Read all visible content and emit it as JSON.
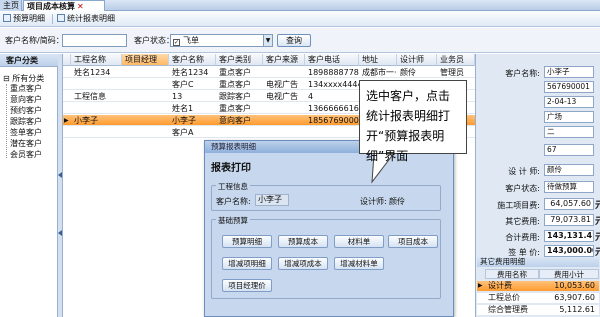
{
  "tabs": [
    {
      "label": "主页"
    },
    {
      "label": "项目成本核算",
      "close": "✕"
    }
  ],
  "toolbar": {
    "budget_detail": "预算明细",
    "print_report": "统计报表明细"
  },
  "search": {
    "name_label": "客户名称/简码：",
    "name_value": "",
    "status_label": "客户状态：",
    "status_value": "飞单",
    "query_button": "查询"
  },
  "left": {
    "title": "客户分类",
    "root": "所有分类",
    "items": [
      "重点客户",
      "意向客户",
      "预约客户",
      "跟踪客户",
      "签单客户",
      "潜在客户",
      "会员客户"
    ]
  },
  "grid": {
    "columns": [
      "工程名称",
      "项目经理",
      "客户名称",
      "客户类别",
      "客户来源",
      "客户电话",
      "地址",
      "设计师",
      "业务员"
    ],
    "rows": [
      [
        "姓名1234",
        "",
        "姓名1234",
        "重点客户",
        "",
        "18988887780",
        "成都市一·4",
        "颜伶",
        "管理员"
      ],
      [
        "",
        "",
        "客户C",
        "重点客户",
        "电视广告",
        "134xxxx4444",
        "",
        "",
        ""
      ],
      [
        "工程信息",
        "",
        "13",
        "跟踪客户",
        "电视广告",
        "4",
        "",
        "",
        ""
      ],
      [
        "",
        "",
        "姓名1",
        "重点客户",
        "",
        "1366666616",
        "",
        "",
        ""
      ],
      [
        "小李子",
        "",
        "小李子",
        "意向客户",
        "",
        "18567690001",
        "",
        "",
        ""
      ],
      [
        "",
        "",
        "客户A",
        "",
        "",
        "",
        "",
        "",
        ""
      ]
    ],
    "selected_marker": "▶"
  },
  "right": {
    "customer_name_label": "客户名称:",
    "customer_name": "小李子",
    "phone": "567690001",
    "date": "2-04-13",
    "source": "广场",
    "area": "二",
    "area2": "67",
    "designer_label": "设 计 师:",
    "designer": "颜伶",
    "status_label": "客户状态:",
    "status": "待做预算",
    "construction_label": "施工项目费:",
    "construction": "64,057.60",
    "other_label": "其它费用:",
    "other": "79,073.81",
    "total_label": "合计费用:",
    "total": "143,131.41",
    "sign_label": "签 单 价:",
    "sign": "143,000.00",
    "unit": "元",
    "other_section": "其它费用明细",
    "other_columns": [
      "费用名称",
      "费用小计"
    ],
    "other_rows": [
      [
        "设计费",
        "10,053.60"
      ],
      [
        "工程总价",
        "63,907.60"
      ],
      [
        "综合管理费",
        "5,112.61"
      ]
    ],
    "row_marker": "▶"
  },
  "dialog": {
    "title": "预算报表明细",
    "heading": "报表打印",
    "group_info": "工程信息",
    "name_label": "客户名称:",
    "name_value": "小李子",
    "designer_label": "设计师:",
    "designer_value": "颜伶",
    "group_budget": "基础预算",
    "buttons": [
      "预算明细",
      "预算成本",
      "材料单",
      "项目成本",
      "增减项明细",
      "增减项成本",
      "增减材料单",
      "项目经理价"
    ]
  },
  "callout": {
    "text": "选中客户，点击统计报表明细打开“预算报表明细”界面"
  }
}
